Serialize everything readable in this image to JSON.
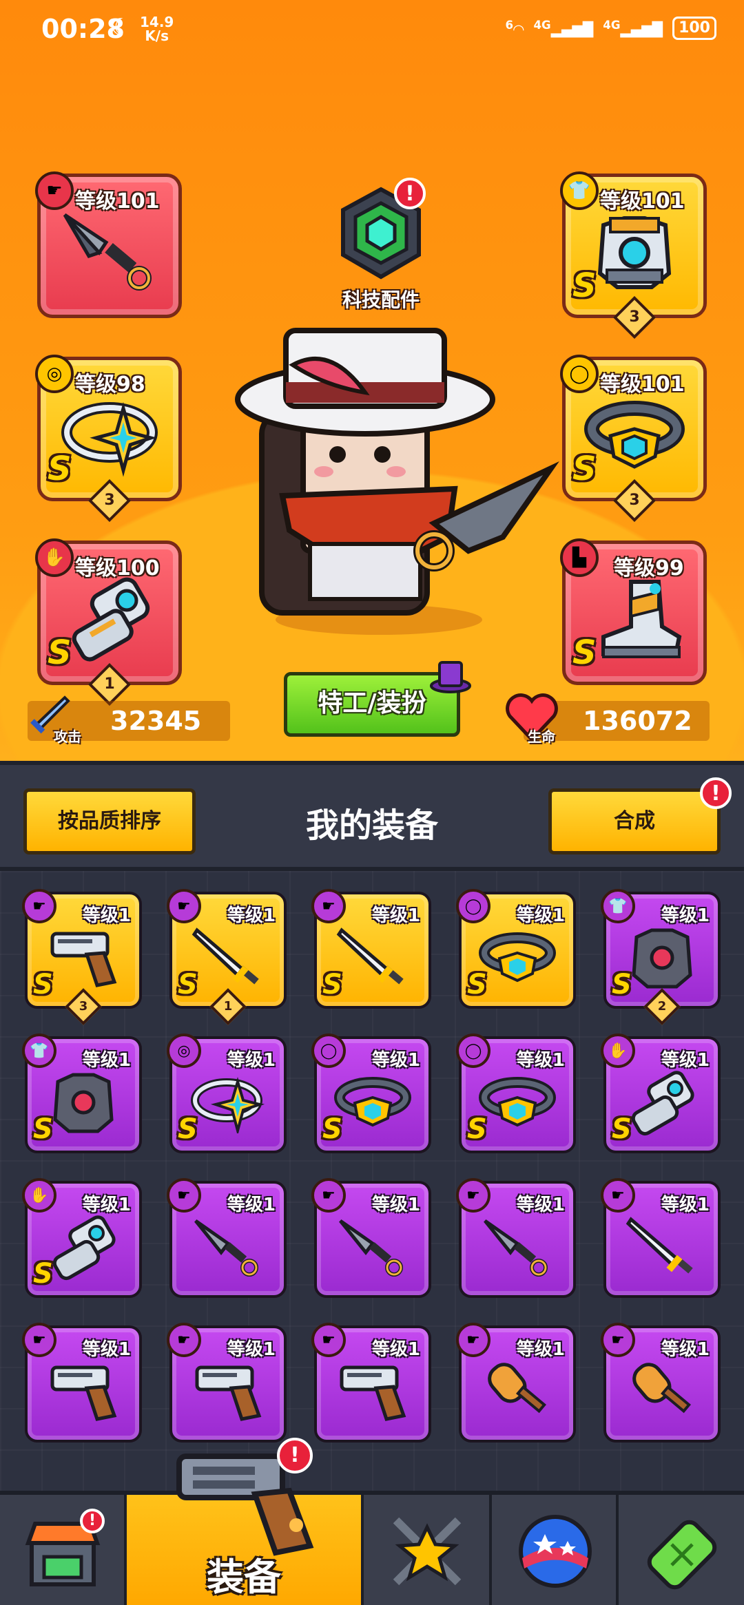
{
  "status_bar": {
    "time": "00:28",
    "speed_value": "14.9",
    "speed_unit": "K/s",
    "net1": "4G",
    "net2": "4G",
    "battery": "100",
    "wifi_num": "6"
  },
  "equipped": {
    "weapon": {
      "level": "等级101"
    },
    "ring": {
      "level": "等级98",
      "grade": "S",
      "stars": "3"
    },
    "glove": {
      "level": "等级100",
      "grade": "S",
      "stars": "1"
    },
    "armor": {
      "level": "等级101",
      "grade": "S",
      "stars": "3"
    },
    "belt": {
      "level": "等级101",
      "grade": "S",
      "stars": "3"
    },
    "boots": {
      "level": "等级99",
      "grade": "S"
    }
  },
  "tech": {
    "label": "科技配件",
    "alert": "!"
  },
  "stats": {
    "attack_label": "攻击",
    "attack_value": "32345",
    "hp_label": "生命",
    "hp_value": "136072"
  },
  "agent_button": "特工/装扮",
  "inventory": {
    "sort_button": "按品质排序",
    "title": "我的装备",
    "merge_button": "合成",
    "merge_alert": "!",
    "items": [
      {
        "level": "等级1",
        "grade": "S",
        "stars": "3",
        "rarity": "yel",
        "icon": "gun-icon"
      },
      {
        "level": "等级1",
        "grade": "S",
        "stars": "1",
        "rarity": "yel",
        "icon": "sword-icon"
      },
      {
        "level": "等级1",
        "grade": "S",
        "stars": "",
        "rarity": "yel",
        "icon": "sword-icon"
      },
      {
        "level": "等级1",
        "grade": "S",
        "stars": "",
        "rarity": "yel",
        "icon": "belt-icon"
      },
      {
        "level": "等级1",
        "grade": "S",
        "stars": "2",
        "rarity": "pur",
        "icon": "armor-icon"
      },
      {
        "level": "等级1",
        "grade": "S",
        "stars": "",
        "rarity": "pur",
        "icon": "armor-icon"
      },
      {
        "level": "等级1",
        "grade": "S",
        "stars": "",
        "rarity": "pur",
        "icon": "ring-icon"
      },
      {
        "level": "等级1",
        "grade": "S",
        "stars": "",
        "rarity": "pur",
        "icon": "belt-icon"
      },
      {
        "level": "等级1",
        "grade": "S",
        "stars": "",
        "rarity": "pur",
        "icon": "belt-icon"
      },
      {
        "level": "等级1",
        "grade": "S",
        "stars": "",
        "rarity": "pur",
        "icon": "glove-icon"
      },
      {
        "level": "等级1",
        "grade": "S",
        "stars": "",
        "rarity": "pur",
        "icon": "glove-icon"
      },
      {
        "level": "等级1",
        "grade": "",
        "stars": "",
        "rarity": "pur",
        "icon": "kunai-icon"
      },
      {
        "level": "等级1",
        "grade": "",
        "stars": "",
        "rarity": "pur",
        "icon": "kunai-icon"
      },
      {
        "level": "等级1",
        "grade": "",
        "stars": "",
        "rarity": "pur",
        "icon": "kunai-icon"
      },
      {
        "level": "等级1",
        "grade": "",
        "stars": "",
        "rarity": "pur",
        "icon": "sword-icon"
      },
      {
        "level": "等级1",
        "grade": "",
        "stars": "",
        "rarity": "pur",
        "icon": "gun-icon"
      },
      {
        "level": "等级1",
        "grade": "",
        "stars": "",
        "rarity": "pur",
        "icon": "gun-icon"
      },
      {
        "level": "等级1",
        "grade": "",
        "stars": "",
        "rarity": "pur",
        "icon": "gun-icon"
      },
      {
        "level": "等级1",
        "grade": "",
        "stars": "",
        "rarity": "pur",
        "icon": "club-icon"
      },
      {
        "level": "等级1",
        "grade": "",
        "stars": "",
        "rarity": "pur",
        "icon": "club-icon"
      }
    ]
  },
  "nav": {
    "equip_label": "装备",
    "alert": "!"
  }
}
